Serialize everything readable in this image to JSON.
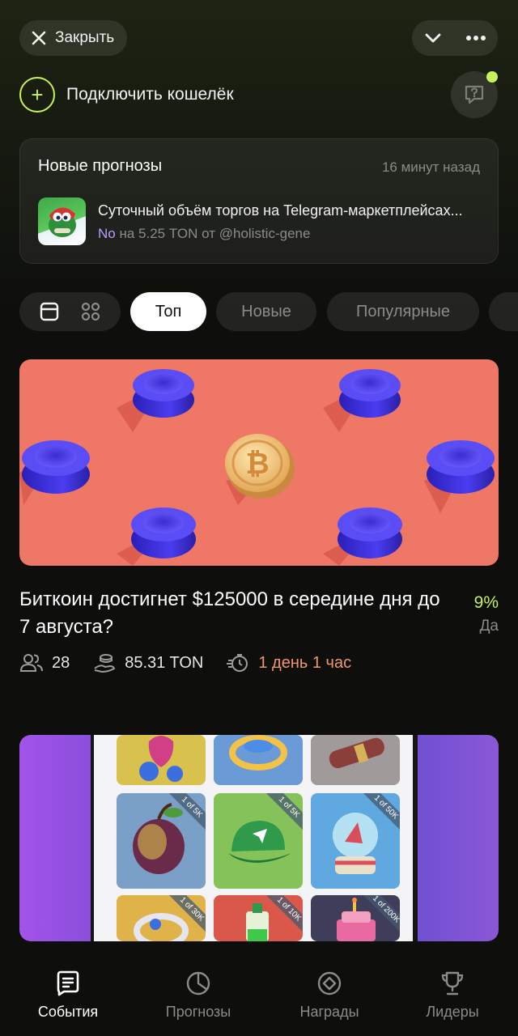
{
  "header": {
    "close_label": "Закрыть",
    "wallet_label": "Подключить кошелёк"
  },
  "forecast_card": {
    "title": "Новые прогнозы",
    "time": "16 минут назад",
    "item_title": "Суточный объём торгов на Telegram-маркетплейсах...",
    "answer": "No",
    "details": "на 5.25 TON от @holistic-gene"
  },
  "filters": {
    "tabs": [
      {
        "label": "Топ",
        "active": true
      },
      {
        "label": "Новые",
        "active": false
      },
      {
        "label": "Популярные",
        "active": false
      }
    ]
  },
  "events": [
    {
      "title": "Биткоин достигнет $125000 в середине дня до 7 августа?",
      "percent": "9%",
      "outcome": "Да",
      "participants": "28",
      "volume": "85.31 TON",
      "deadline": "1 день 1 час"
    },
    {
      "gift_tags": [
        "1 of 5K",
        "1 of 5K",
        "1 of 50K",
        "1 of 30K",
        "1 of 10K",
        "1 of 200K"
      ]
    }
  ],
  "bottom_nav": [
    {
      "label": "События",
      "icon": "events-icon",
      "active": true
    },
    {
      "label": "Прогнозы",
      "icon": "forecasts-icon",
      "active": false
    },
    {
      "label": "Награды",
      "icon": "rewards-icon",
      "active": false
    },
    {
      "label": "Лидеры",
      "icon": "trophy-icon",
      "active": false
    }
  ],
  "colors": {
    "accent": "#c8f25b",
    "deadline": "#f0976a",
    "answer_no": "#b99cff",
    "background": "#0e0f0c"
  }
}
